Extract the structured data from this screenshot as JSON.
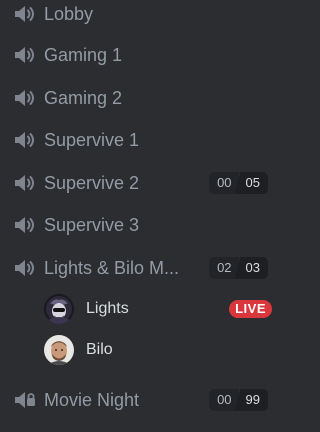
{
  "channels": [
    {
      "name": "Lobby"
    },
    {
      "name": "Gaming 1"
    },
    {
      "name": "Gaming 2"
    },
    {
      "name": "Supervive 1"
    },
    {
      "name": "Supervive 2",
      "current": "00",
      "limit": "05"
    },
    {
      "name": "Supervive 3"
    },
    {
      "name": "Lights & Bilo M...",
      "current": "02",
      "limit": "03"
    },
    {
      "name": "Movie Night",
      "current": "00",
      "limit": "99"
    }
  ],
  "voice_users": [
    {
      "name": "Lights",
      "badge": "LIVE"
    },
    {
      "name": "Bilo"
    }
  ],
  "icons": {
    "channel": "speaker-icon",
    "movie_channel": "speaker-lock-icon"
  },
  "colors": {
    "background": "#2b2d31",
    "text": "#949ba4",
    "live": "#da373c"
  }
}
